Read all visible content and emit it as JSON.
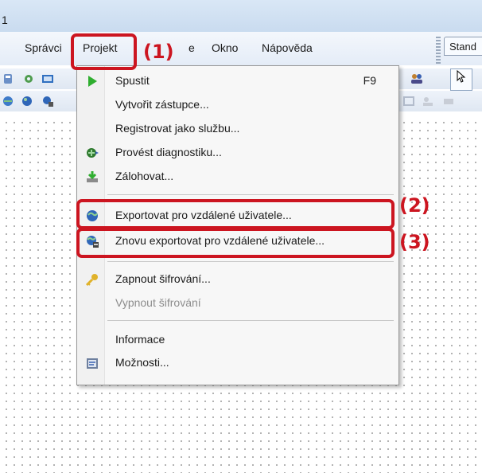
{
  "window": {
    "title_fragment": "1"
  },
  "menubar": {
    "items": [
      {
        "label": "Správci"
      },
      {
        "label": "Projekt"
      },
      {
        "label": "e"
      },
      {
        "label": "Okno"
      },
      {
        "label": "Nápověda"
      }
    ],
    "toolbar_tab": "Stand"
  },
  "menu": {
    "items": [
      {
        "label": "Spustit",
        "shortcut": "F9",
        "icon": "play-icon"
      },
      {
        "label": "Vytvořit zástupce...",
        "icon": ""
      },
      {
        "label": "Registrovat jako službu...",
        "icon": ""
      },
      {
        "label": "Provést diagnostiku...",
        "icon": "diagnostics-icon"
      },
      {
        "label": "Zálohovat...",
        "icon": "backup-icon"
      },
      {
        "label": "Exportovat pro vzdálené uživatele...",
        "icon": "globe-export-icon"
      },
      {
        "label": "Znovu exportovat pro vzdálené uživatele...",
        "icon": "globe-reexport-icon"
      },
      {
        "label": "Zapnout šifrování...",
        "icon": "key-icon"
      },
      {
        "label": "Vypnout šifrování",
        "icon": "",
        "disabled": true
      },
      {
        "label": "Informace",
        "icon": ""
      },
      {
        "label": "Možnosti...",
        "icon": "options-icon"
      }
    ]
  },
  "annotations": {
    "step1": "(1)",
    "step2": "(2)",
    "step3": "(3)",
    "color": "#cc1520"
  }
}
